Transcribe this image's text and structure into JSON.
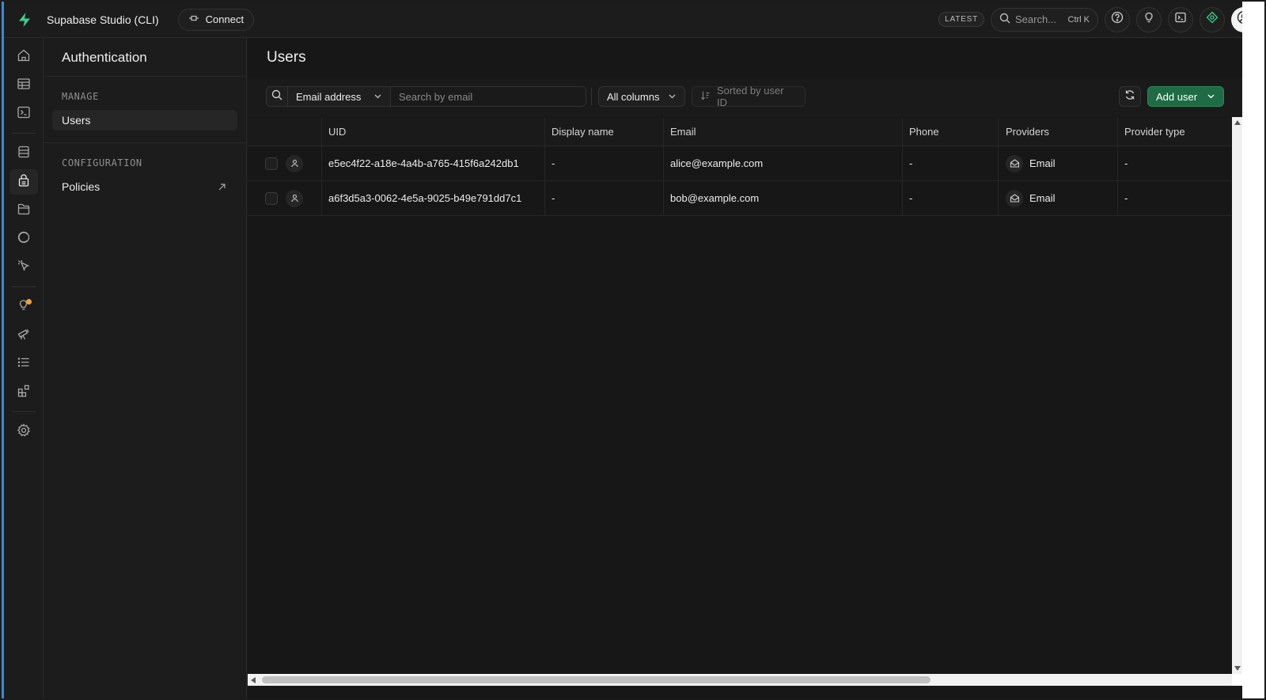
{
  "app": {
    "title": "Supabase Studio (CLI)",
    "connect_label": "Connect",
    "brand_color": "#3ecf8e"
  },
  "topbar": {
    "badge": "LATEST",
    "search_label": "Search...",
    "search_shortcut": "Ctrl K",
    "icons": [
      "help-icon",
      "lightbulb-icon",
      "terminal-icon",
      "assistant-icon",
      "user-avatar-icon"
    ]
  },
  "rail": {
    "items": [
      "home-icon",
      "table-editor-icon",
      "sql-editor-icon",
      "database-icon",
      "authentication-icon",
      "storage-icon",
      "realtime-icon",
      "edge-functions-icon",
      "advisors-icon",
      "reports-icon",
      "logs-icon",
      "integrations-icon",
      "settings-icon"
    ],
    "active": "authentication-icon",
    "notification_color": "#f3a23a"
  },
  "sidebar": {
    "title": "Authentication",
    "sections": [
      {
        "label": "MANAGE",
        "items": [
          {
            "label": "Users",
            "active": true
          }
        ]
      },
      {
        "label": "CONFIGURATION",
        "items": [
          {
            "label": "Policies",
            "external": true
          }
        ]
      }
    ]
  },
  "main": {
    "title": "Users",
    "filter": {
      "field": "Email address",
      "placeholder": "Search by email"
    },
    "columns_label": "All columns",
    "sort_label": "Sorted by user ID",
    "add_user_label": "Add user",
    "add_user_color": "#1e6b45"
  },
  "table": {
    "headers": [
      "UID",
      "Display name",
      "Email",
      "Phone",
      "Providers",
      "Provider type"
    ],
    "rows": [
      {
        "uid": "e5ec4f22-a18e-4a4b-a765-415f6a242db1",
        "display_name": "-",
        "email": "alice@example.com",
        "phone": "-",
        "provider": "Email",
        "provider_type": "-"
      },
      {
        "uid": "a6f3d5a3-0062-4e5a-9025-b49e791dd7c1",
        "display_name": "-",
        "email": "bob@example.com",
        "phone": "-",
        "provider": "Email",
        "provider_type": "-"
      }
    ]
  }
}
